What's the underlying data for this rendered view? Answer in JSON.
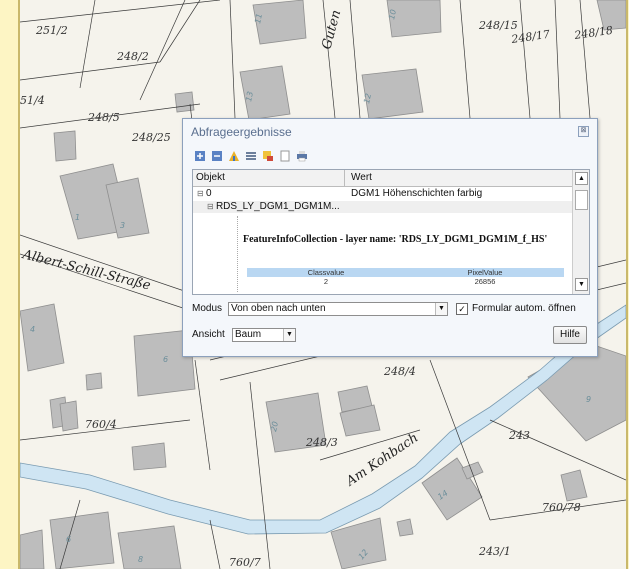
{
  "map": {
    "parcels": [
      "251/2",
      "248/2",
      "51/4",
      "248/5",
      "248/25",
      "248/15",
      "248/17",
      "248/18",
      "248/4",
      "760/4",
      "248/3",
      "243",
      "760/78",
      "760/7",
      "243/1"
    ],
    "streets": [
      "Guten",
      "Albert-Schill-Straße",
      "Am Kohbach"
    ],
    "house_numbers": [
      "11",
      "10",
      "13",
      "12",
      "1",
      "3",
      "4",
      "6",
      "20",
      "9",
      "14",
      "6",
      "8",
      "12"
    ]
  },
  "dialog": {
    "title": "Abfrageergebnisse",
    "close_label": "⊠",
    "toolbar_icons": [
      "expand-all-icon",
      "collapse-all-icon",
      "highlight-icon",
      "list-icon",
      "export-icon",
      "document-icon",
      "print-icon"
    ],
    "grid": {
      "col_objekt": "Objekt",
      "col_wert": "Wert",
      "row0_objekt": "0",
      "row0_wert": "DGM1 Höhenschichten farbig",
      "row1_objekt": "RDS_LY_DGM1_DGM1M..."
    },
    "feature_info": {
      "title": "FeatureInfoCollection - layer name: 'RDS_LY_DGM1_DGM1M_f_HS'",
      "headers": [
        "Classvalue",
        "PixelValue"
      ],
      "row": [
        "2",
        "26856"
      ]
    },
    "modus_label": "Modus",
    "modus_value": "Von oben nach unten",
    "auto_open_label": "Formular autom. öffnen",
    "auto_open_checked": true,
    "ansicht_label": "Ansicht",
    "ansicht_value": "Baum",
    "help_label": "Hilfe"
  },
  "colors": {
    "outer_background": "#fdf5c4",
    "map_background": "#f5f3ec",
    "building_fill": "#bdbdbd",
    "stream_fill": "#cfe5f3",
    "dialog_background": "#f4f7fb",
    "table_header_blue": "#b9d7f2"
  }
}
